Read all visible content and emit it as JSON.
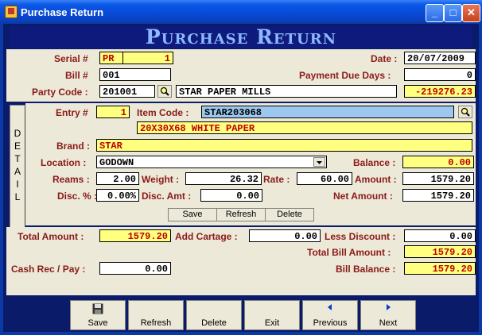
{
  "window": {
    "title": "Purchase Return"
  },
  "banner": "Purchase Return",
  "header": {
    "serial_label": "Serial #",
    "serial_prefix": "PR",
    "serial_no": "1",
    "date_label": "Date :",
    "date": "20/07/2009",
    "bill_label": "Bill #",
    "bill": "001",
    "due_label": "Payment Due Days :",
    "due_days": "0",
    "party_label": "Party Code :",
    "party_code": "201001",
    "party_name": "STAR PAPER MILLS",
    "party_balance": "-219276.23"
  },
  "detail": {
    "tab_letters": [
      "D",
      "E",
      "T",
      "A",
      "I",
      "L"
    ],
    "entry_label": "Entry #",
    "entry_no": "1",
    "item_label": "Item Code :",
    "item_code": "STAR203068",
    "item_desc": "20X30X68 WHITE PAPER",
    "brand_label": "Brand :",
    "brand": "STAR",
    "location_label": "Location :",
    "location": "GODOWN",
    "balance_label": "Balance :",
    "balance": "0.00",
    "reams_label": "Reams :",
    "reams": "2.00",
    "weight_label": "Weight :",
    "weight": "26.32",
    "rate_label": "Rate :",
    "rate": "60.00",
    "amount_label": "Amount :",
    "amount": "1579.20",
    "disc_pct_label": "Disc. % :",
    "disc_pct": "0.00%",
    "disc_amt_label": "Disc. Amt :",
    "disc_amt": "0.00",
    "net_label": "Net Amount :",
    "net_amount": "1579.20",
    "save": "Save",
    "refresh": "Refresh",
    "delete": "Delete"
  },
  "totals": {
    "total_label": "Total Amount :",
    "total": "1579.20",
    "cartage_label": "Add Cartage :",
    "cartage": "0.00",
    "less_disc_label": "Less Discount :",
    "less_disc": "0.00",
    "total_bill_label": "Total Bill Amount :",
    "total_bill": "1579.20",
    "cash_label": "Cash Rec / Pay :",
    "cash": "0.00",
    "bill_bal_label": "Bill Balance :",
    "bill_balance": "1579.20"
  },
  "toolbar": {
    "save": "Save",
    "refresh": "Refresh",
    "delete": "Delete",
    "exit": "Exit",
    "previous": "Previous",
    "next": "Next"
  },
  "colors": {
    "label": "#8b1a1a",
    "highlight": "#ffff80",
    "selected": "#9cc8f0",
    "frame": "#0a1b6a"
  },
  "icons": [
    "app-icon",
    "minimize-icon",
    "maximize-icon",
    "close-icon",
    "search-icon",
    "dropdown-arrow-icon",
    "floppy-disk-icon",
    "triangle-left-icon",
    "triangle-right-icon"
  ]
}
